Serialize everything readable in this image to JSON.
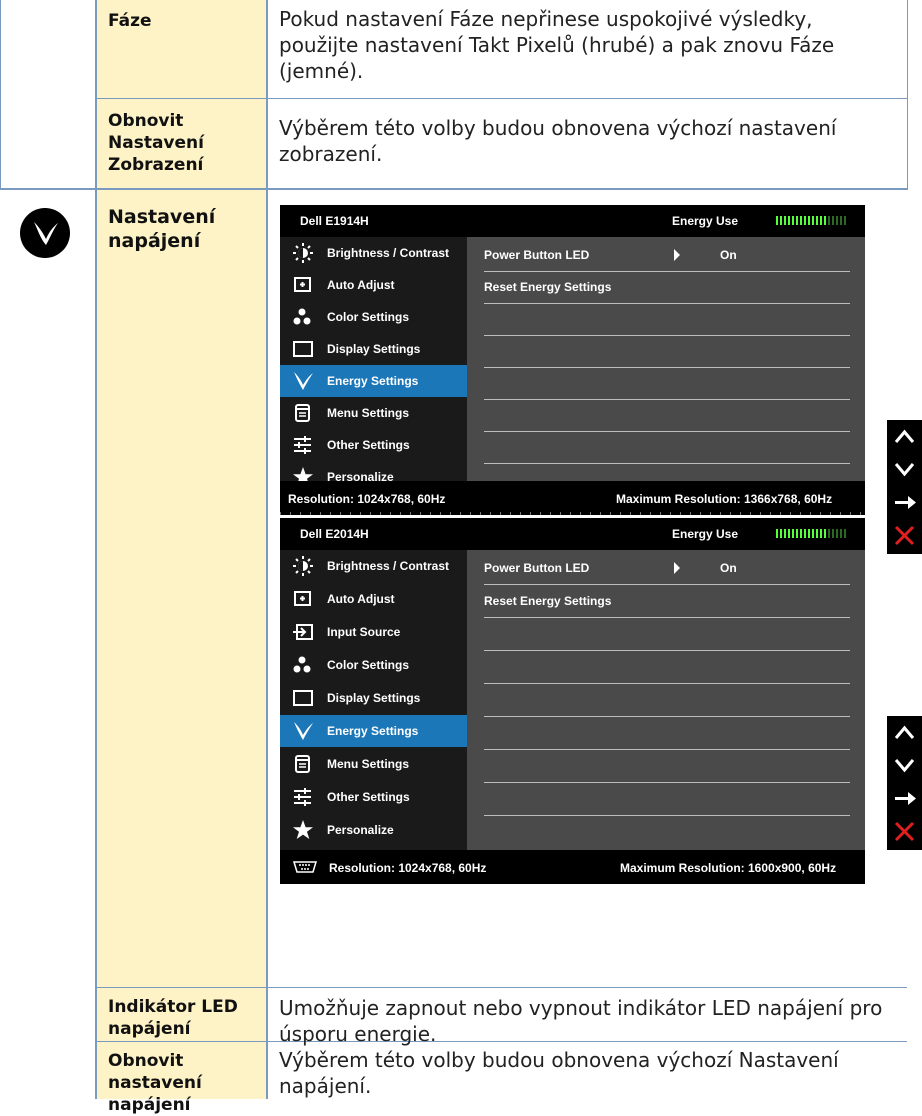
{
  "rows": [
    {
      "label": "Fáze",
      "description": "Pokud nastavení Fáze nepřinese uspokojivé výsledky, použijte nastavení Takt Pixelů (hrubé) a pak znovu Fáze (jemné)."
    },
    {
      "label": "Obnovit Nastavení Zobrazení",
      "description": "Výběrem této volby budou obnovena výchozí nastavení zobrazení."
    },
    {
      "label": "Nastavení napájení",
      "icon": "energy-leaf-icon"
    },
    {
      "label": "Indikátor LED napájení",
      "description": "Umožňuje zapnout nebo vypnout indikátor LED napájení pro úsporu energie."
    },
    {
      "label": "Obnovit nastavení napájení",
      "description": "Výběrem této volby budou obnovena výchozí Nastavení napájení."
    }
  ],
  "osd1": {
    "model": "Dell E1914H",
    "energy_use": "Energy Use",
    "menu": [
      {
        "label": "Brightness / Contrast",
        "icon": "sun-icon"
      },
      {
        "label": "Auto Adjust",
        "icon": "auto-adjust-icon"
      },
      {
        "label": "Color Settings",
        "icon": "color-dots-icon"
      },
      {
        "label": "Display Settings",
        "icon": "display-rect-icon"
      },
      {
        "label": "Energy Settings",
        "icon": "energy-leaf-icon",
        "selected": true
      },
      {
        "label": "Menu Settings",
        "icon": "menu-list-icon"
      },
      {
        "label": "Other Settings",
        "icon": "sliders-icon"
      },
      {
        "label": "Personalize",
        "icon": "star-icon"
      }
    ],
    "options": [
      {
        "label": "Power Button LED",
        "value": "On"
      },
      {
        "label": "Reset Energy Settings",
        "value": ""
      }
    ],
    "resolution": "Resolution: 1024x768, 60Hz",
    "max_resolution": "Maximum Resolution: 1366x768, 60Hz"
  },
  "osd2": {
    "model": "Dell E2014H",
    "energy_use": "Energy Use",
    "menu": [
      {
        "label": "Brightness / Contrast",
        "icon": "sun-icon"
      },
      {
        "label": "Auto Adjust",
        "icon": "auto-adjust-icon"
      },
      {
        "label": "Input Source",
        "icon": "input-source-icon"
      },
      {
        "label": "Color Settings",
        "icon": "color-dots-icon"
      },
      {
        "label": "Display Settings",
        "icon": "display-rect-icon"
      },
      {
        "label": "Energy Settings",
        "icon": "energy-leaf-icon",
        "selected": true
      },
      {
        "label": "Menu Settings",
        "icon": "menu-list-icon"
      },
      {
        "label": "Other Settings",
        "icon": "sliders-icon"
      },
      {
        "label": "Personalize",
        "icon": "star-icon"
      }
    ],
    "options": [
      {
        "label": "Power Button LED",
        "value": "On"
      },
      {
        "label": "Reset Energy Settings",
        "value": ""
      }
    ],
    "resolution": "Resolution: 1024x768, 60Hz",
    "max_resolution": "Maximum Resolution: 1600x900, 60Hz"
  },
  "nav_buttons": [
    "up-arrow-icon",
    "down-arrow-icon",
    "right-arrow-icon",
    "close-x-icon"
  ],
  "colors": {
    "highlight": "#1b77b8",
    "cell_bg": "#fdf3c6",
    "grid_line": "#7a9bbf",
    "meter_green": "#55ff3a",
    "close_red": "#e02020"
  }
}
